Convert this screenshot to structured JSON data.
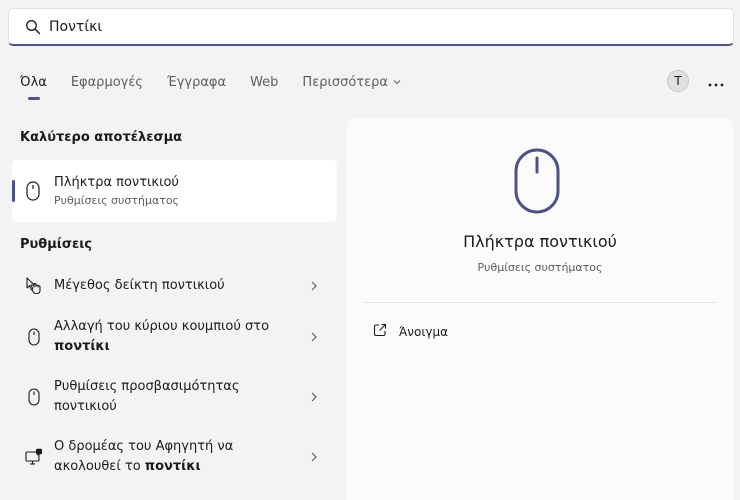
{
  "search": {
    "value": "Ποντίκι"
  },
  "tabs": [
    {
      "label": "Όλα"
    },
    {
      "label": "Εφαρμογές"
    },
    {
      "label": "Έγγραφα"
    },
    {
      "label": "Web"
    },
    {
      "label": "Περισσότερα"
    }
  ],
  "user": {
    "initial": "T"
  },
  "best_match": {
    "heading": "Καλύτερο αποτέλεσμα",
    "title": "Πλήκτρα ποντικιού",
    "subtitle": "Ρυθμίσεις συστήματος"
  },
  "settings": {
    "heading": "Ρυθμίσεις",
    "items": [
      {
        "text": "Μέγεθος δείκτη ποντικιού"
      },
      {
        "line1": "Αλλαγή του κύριου κουμπιού στο",
        "bold": "ποντίκι"
      },
      {
        "line1": "Ρυθμίσεις προσβασιμότητας",
        "line2": "ποντικιού"
      },
      {
        "line1": "Ο δρομέας του Αφηγητή να",
        "pre": "ακολουθεί το ",
        "bold": "ποντίκι"
      }
    ]
  },
  "detail": {
    "title": "Πλήκτρα ποντικιού",
    "subtitle": "Ρυθμίσεις συστήματος",
    "open_label": "Άνοιγμα"
  },
  "colors": {
    "accent": "#4d5183"
  }
}
